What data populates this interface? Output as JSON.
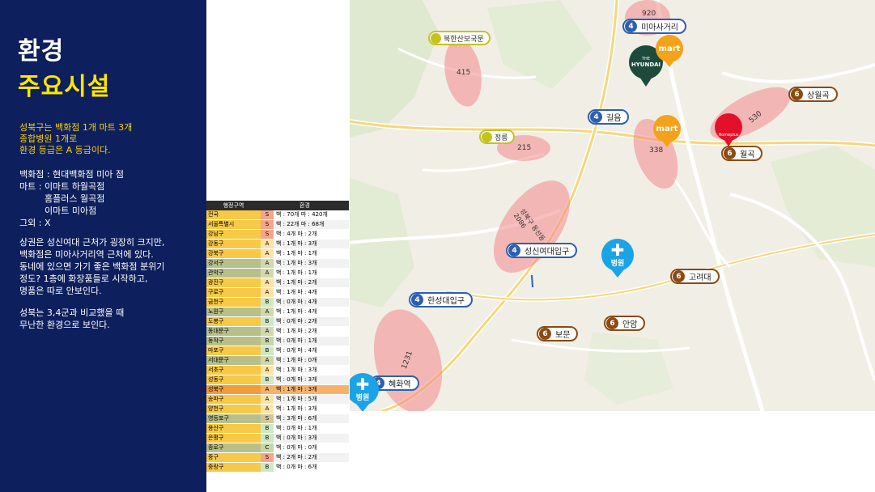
{
  "title": {
    "line1": "환경",
    "line2": "주요시설"
  },
  "summary": [
    "성북구는 백화점 1개 마트 3개",
    "종합병원 1개로",
    "환경 등급은 A 등급이다."
  ],
  "facilities": {
    "department_store": "백화점 : 현대백화점 미아 점",
    "mart_1": "마트 : 이마트 하월곡점",
    "mart_2": "홈플러스 월곡점",
    "mart_3": "이마트 미아점",
    "other": "그외 : X"
  },
  "analysis": [
    "상권은 성신여대 근처가 굉장히 크지만,",
    "백화점은 미아사거리역 근처에 있다.",
    "동네에 있으면 가기 좋은 백화점 분위기",
    "정도? 1층에 화장품들로 시작하고,",
    "명품은 따로 안보인다."
  ],
  "conclusion": [
    "성북는 3,4군과 비교했을 때",
    "무난한 환경으로 보인다."
  ],
  "table": {
    "headers": {
      "region": "행정구역",
      "env": "환경"
    },
    "rows": [
      {
        "region": "전국",
        "grade": "S",
        "detail": "백 : 70개 마 : 420개",
        "color": "#f7c948",
        "grade_color": "#f4a58a"
      },
      {
        "region": "서울특별시",
        "grade": "S",
        "detail": "백 : 22개 마 : 68개",
        "color": "#f7c948",
        "grade_color": "#f4a58a"
      },
      {
        "region": "강남구",
        "grade": "S",
        "detail": "백 : 4개 마 : 2개",
        "color": "#f7c948",
        "grade_color": "#f4a58a"
      },
      {
        "region": "강동구",
        "grade": "A",
        "detail": "백 : 1개 마 : 3개",
        "color": "#f7c948",
        "grade_color": "#fde3a6"
      },
      {
        "region": "강북구",
        "grade": "A",
        "detail": "백 : 1개 마 : 1개",
        "color": "#f7c948",
        "grade_color": "#fde3a6"
      },
      {
        "region": "강서구",
        "grade": "A",
        "detail": "백 : 1개 마 : 3개",
        "color": "#b7c08a",
        "grade_color": "#d2d8ae"
      },
      {
        "region": "관악구",
        "grade": "A",
        "detail": "백 : 1개 마 : 1개",
        "color": "#b7c08a",
        "grade_color": "#d2d8ae"
      },
      {
        "region": "광진구",
        "grade": "A",
        "detail": "백 : 1개 마 : 2개",
        "color": "#f7c948",
        "grade_color": "#fde3a6"
      },
      {
        "region": "구로구",
        "grade": "A",
        "detail": "백 : 1개 마 : 4개",
        "color": "#f7c948",
        "grade_color": "#fde3a6"
      },
      {
        "region": "금천구",
        "grade": "B",
        "detail": "백 : 0개 마 : 4개",
        "color": "#f7c948",
        "grade_color": "#cfe8c4"
      },
      {
        "region": "노원구",
        "grade": "A",
        "detail": "백 : 1개 마 : 4개",
        "color": "#b7c08a",
        "grade_color": "#d2d8ae"
      },
      {
        "region": "도봉구",
        "grade": "B",
        "detail": "백 : 0개 마 : 2개",
        "color": "#f7c948",
        "grade_color": "#cfe8c4"
      },
      {
        "region": "동대문구",
        "grade": "A",
        "detail": "백 : 1개 마 : 2개",
        "color": "#b7c08a",
        "grade_color": "#d2d8ae"
      },
      {
        "region": "동작구",
        "grade": "B",
        "detail": "백 : 0개 마 : 1개",
        "color": "#b7c08a",
        "grade_color": "#c6d6a8"
      },
      {
        "region": "마포구",
        "grade": "B",
        "detail": "백 : 0개 마 : 4개",
        "color": "#f7c948",
        "grade_color": "#cfe8c4"
      },
      {
        "region": "서대문구",
        "grade": "A",
        "detail": "백 : 1개 마 : 0개",
        "color": "#b7c08a",
        "grade_color": "#d2d8ae"
      },
      {
        "region": "서초구",
        "grade": "A",
        "detail": "백 : 1개 마 : 3개",
        "color": "#f7c948",
        "grade_color": "#fde3a6"
      },
      {
        "region": "성동구",
        "grade": "B",
        "detail": "백 : 0개 마 : 3개",
        "color": "#f7c948",
        "grade_color": "#cfe8c4"
      },
      {
        "region": "성북구",
        "grade": "A",
        "detail": "백 : 1개 마 : 3개",
        "color": "#f39c3a",
        "grade_color": "#f6b26b"
      },
      {
        "region": "송파구",
        "grade": "A",
        "detail": "백 : 1개 마 : 5개",
        "color": "#f7c948",
        "grade_color": "#fde3a6"
      },
      {
        "region": "양천구",
        "grade": "A",
        "detail": "백 : 1개 마 : 3개",
        "color": "#f7c948",
        "grade_color": "#fde3a6"
      },
      {
        "region": "영등포구",
        "grade": "S",
        "detail": "백 : 3개 마 : 6개",
        "color": "#b7c08a",
        "grade_color": "#d2c79a"
      },
      {
        "region": "용산구",
        "grade": "B",
        "detail": "백 : 0개 마 : 1개",
        "color": "#f7c948",
        "grade_color": "#cfe8c4"
      },
      {
        "region": "은평구",
        "grade": "B",
        "detail": "백 : 0개 마 : 3개",
        "color": "#f7c948",
        "grade_color": "#cfe8c4"
      },
      {
        "region": "종로구",
        "grade": "C",
        "detail": "백 : 0개 마 : 0개",
        "color": "#b7c08a",
        "grade_color": "#c6d6a8"
      },
      {
        "region": "중구",
        "grade": "S",
        "detail": "백 : 2개 마 : 2개",
        "color": "#f7c948",
        "grade_color": "#f4a58a"
      },
      {
        "region": "중랑구",
        "grade": "B",
        "detail": "백 : 0개 마 : 6개",
        "color": "#f7c948",
        "grade_color": "#cfe8c4"
      }
    ]
  },
  "map": {
    "stations": [
      {
        "num": "4",
        "name": "미아사거리",
        "line": "4"
      },
      {
        "num": "6",
        "name": "상월곡",
        "line": "6"
      },
      {
        "num": "4",
        "name": "길음",
        "line": "4"
      },
      {
        "num": "6",
        "name": "월곡",
        "line": "6"
      },
      {
        "num": "4",
        "name": "성신여대입구",
        "line": "4"
      },
      {
        "num": "6",
        "name": "고려대",
        "line": "6"
      },
      {
        "num": "4",
        "name": "한성대입구",
        "line": "4"
      },
      {
        "num": "6",
        "name": "안암",
        "line": "6"
      },
      {
        "num": "6",
        "name": "보문",
        "line": "6"
      },
      {
        "num": "4",
        "name": "혜화역",
        "line": "4"
      }
    ],
    "pois": [
      {
        "name": "북한산보국문"
      },
      {
        "name": "정릉"
      }
    ],
    "ellipse_labels": [
      "920",
      "415",
      "530",
      "215",
      "338",
      "성북구 동선동 2086",
      "1231"
    ],
    "hospital_label": "병원",
    "hospital_cross": "✚",
    "emart_label": "mart",
    "hyundai_small": "THE",
    "hyundai_big": "HYUNDAI",
    "homeplus_label": "Homeplus"
  }
}
